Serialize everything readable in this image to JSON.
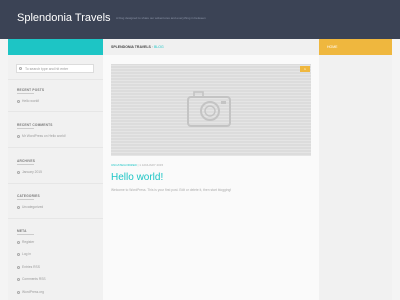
{
  "header": {
    "site_title": "Splendonia Travels",
    "tagline": "A blog designed to share our adventures and everything in between"
  },
  "breadcrumb": {
    "home": "SPLENDONIA TRAVELS",
    "separator": "›",
    "current": "BLOG"
  },
  "right_band": {
    "home_label": "HOME"
  },
  "search": {
    "placeholder": "To search type and hit enter"
  },
  "sidebar": {
    "recent_posts": {
      "title": "RECENT POSTS",
      "items": [
        "Hello world!"
      ]
    },
    "recent_comments": {
      "title": "RECENT COMMENTS",
      "items": [
        "Mr WordPress on Hello world!"
      ]
    },
    "archives": {
      "title": "ARCHIVES",
      "items": [
        "January 2015"
      ]
    },
    "categories": {
      "title": "CATEGORIES",
      "items": [
        "Uncategorized"
      ]
    },
    "meta": {
      "title": "META",
      "items": [
        "Register",
        "Log in",
        "Entries RSS",
        "Comments RSS",
        "WordPress.org"
      ]
    }
  },
  "post": {
    "comment_count": "1",
    "category": "UNCATEGORIZED",
    "meta_sep": "|",
    "date": "1 JANUARY 2015",
    "title": "Hello world!",
    "excerpt": "Welcome to WordPress. This is your first post. Edit or delete it, then start blogging!"
  },
  "colors": {
    "header_bg": "#3b4355",
    "accent_teal": "#1dc5c5",
    "accent_yellow": "#efb73e"
  },
  "icons": {
    "search": "search-icon",
    "camera_placeholder": "camera-icon",
    "list_bullet": "circle-bullet-icon"
  }
}
